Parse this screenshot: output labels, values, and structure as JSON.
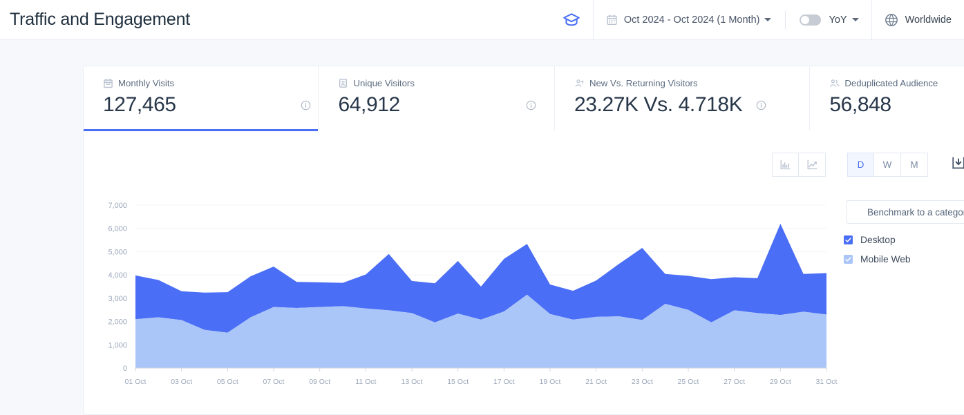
{
  "header": {
    "title": "Traffic and Engagement",
    "academy_icon": "graduation-cap-icon",
    "calendar_icon": "calendar-icon",
    "date_range": "Oct 2024 - Oct 2024 (1 Month)",
    "yoy_label": "YoY",
    "yoy_toggle_on": false,
    "globe_icon": "globe-icon",
    "region": "Worldwide"
  },
  "metrics": [
    {
      "icon": "calendar-icon",
      "label": "Monthly Visits",
      "value": "127,465",
      "active": true,
      "has_info": true
    },
    {
      "icon": "id-card-icon",
      "label": "Unique Visitors",
      "value": "64,912",
      "active": false,
      "has_info": true
    },
    {
      "icon": "user-plus-icon",
      "label": "New Vs. Returning Visitors",
      "value": "23.27K Vs. 4.718K",
      "active": false,
      "has_info": true
    },
    {
      "icon": "users-icon",
      "label": "Deduplicated Audience",
      "value": "56,848",
      "active": false,
      "has_info": false
    }
  ],
  "toolbar": {
    "chart_type_bar": "bar-chart-icon",
    "chart_type_line": "line-chart-icon",
    "granularity": [
      "D",
      "W",
      "M"
    ],
    "granularity_selected": "D",
    "download_icon": "download-icon"
  },
  "legend": {
    "benchmark_label": "Benchmark to a category",
    "items": [
      {
        "label": "Desktop",
        "checked": true,
        "color": "#4a6ef5"
      },
      {
        "label": "Mobile Web",
        "checked": true,
        "color": "#aac5f8"
      }
    ]
  },
  "colors": {
    "accent": "#4a6ef5",
    "desktop": "#4a6ef5",
    "mobile_web": "#aac5f8",
    "page_bg": "#f6f8fc",
    "text_dark": "#28374a",
    "text_muted": "#9aa6b8"
  },
  "chart_data": {
    "type": "area",
    "stacked": true,
    "title": "",
    "xlabel": "",
    "ylabel": "",
    "ylim": [
      0,
      7000
    ],
    "yticks": [
      0,
      1000,
      2000,
      3000,
      4000,
      5000,
      6000,
      7000
    ],
    "ytick_labels": [
      "0",
      "1,000",
      "2,000",
      "3,000",
      "4,000",
      "5,000",
      "6,000",
      "7,000"
    ],
    "grid": true,
    "legend_position": "right",
    "x": [
      "01 Oct",
      "02 Oct",
      "03 Oct",
      "04 Oct",
      "05 Oct",
      "06 Oct",
      "07 Oct",
      "08 Oct",
      "09 Oct",
      "10 Oct",
      "11 Oct",
      "12 Oct",
      "13 Oct",
      "14 Oct",
      "15 Oct",
      "16 Oct",
      "17 Oct",
      "18 Oct",
      "19 Oct",
      "20 Oct",
      "21 Oct",
      "22 Oct",
      "23 Oct",
      "24 Oct",
      "25 Oct",
      "26 Oct",
      "27 Oct",
      "28 Oct",
      "29 Oct",
      "30 Oct",
      "31 Oct"
    ],
    "xtick_labels": [
      "01 Oct",
      "03 Oct",
      "05 Oct",
      "07 Oct",
      "09 Oct",
      "11 Oct",
      "13 Oct",
      "15 Oct",
      "17 Oct",
      "19 Oct",
      "21 Oct",
      "23 Oct",
      "25 Oct",
      "27 Oct",
      "29 Oct",
      "31 Oct"
    ],
    "series": [
      {
        "name": "Mobile Web",
        "color": "#aac5f8",
        "values": [
          2100,
          2180,
          2060,
          1640,
          1520,
          2180,
          2620,
          2580,
          2620,
          2660,
          2560,
          2480,
          2360,
          1960,
          2340,
          2080,
          2430,
          3150,
          2320,
          2080,
          2200,
          2220,
          2060,
          2760,
          2500,
          1960,
          2480,
          2360,
          2280,
          2420,
          2300
        ]
      },
      {
        "name": "Desktop",
        "color": "#4a6ef5",
        "values": [
          1880,
          1600,
          1240,
          1600,
          1740,
          1760,
          1740,
          1120,
          1060,
          1000,
          1460,
          2420,
          1380,
          1680,
          2260,
          1420,
          2260,
          2180,
          1270,
          1240,
          1560,
          2260,
          3100,
          1280,
          1460,
          1860,
          1420,
          1500,
          3920,
          1620,
          1780
        ]
      }
    ],
    "total_values": [
      3980,
      3780,
      3300,
      3240,
      3260,
      3940,
      4360,
      3700,
      3680,
      3660,
      4020,
      4900,
      3740,
      3640,
      4600,
      3500,
      4690,
      5330,
      3590,
      3320,
      3760,
      4480,
      5160,
      4040,
      3960,
      3820,
      3900,
      3860,
      6200,
      4040,
      4080
    ]
  }
}
